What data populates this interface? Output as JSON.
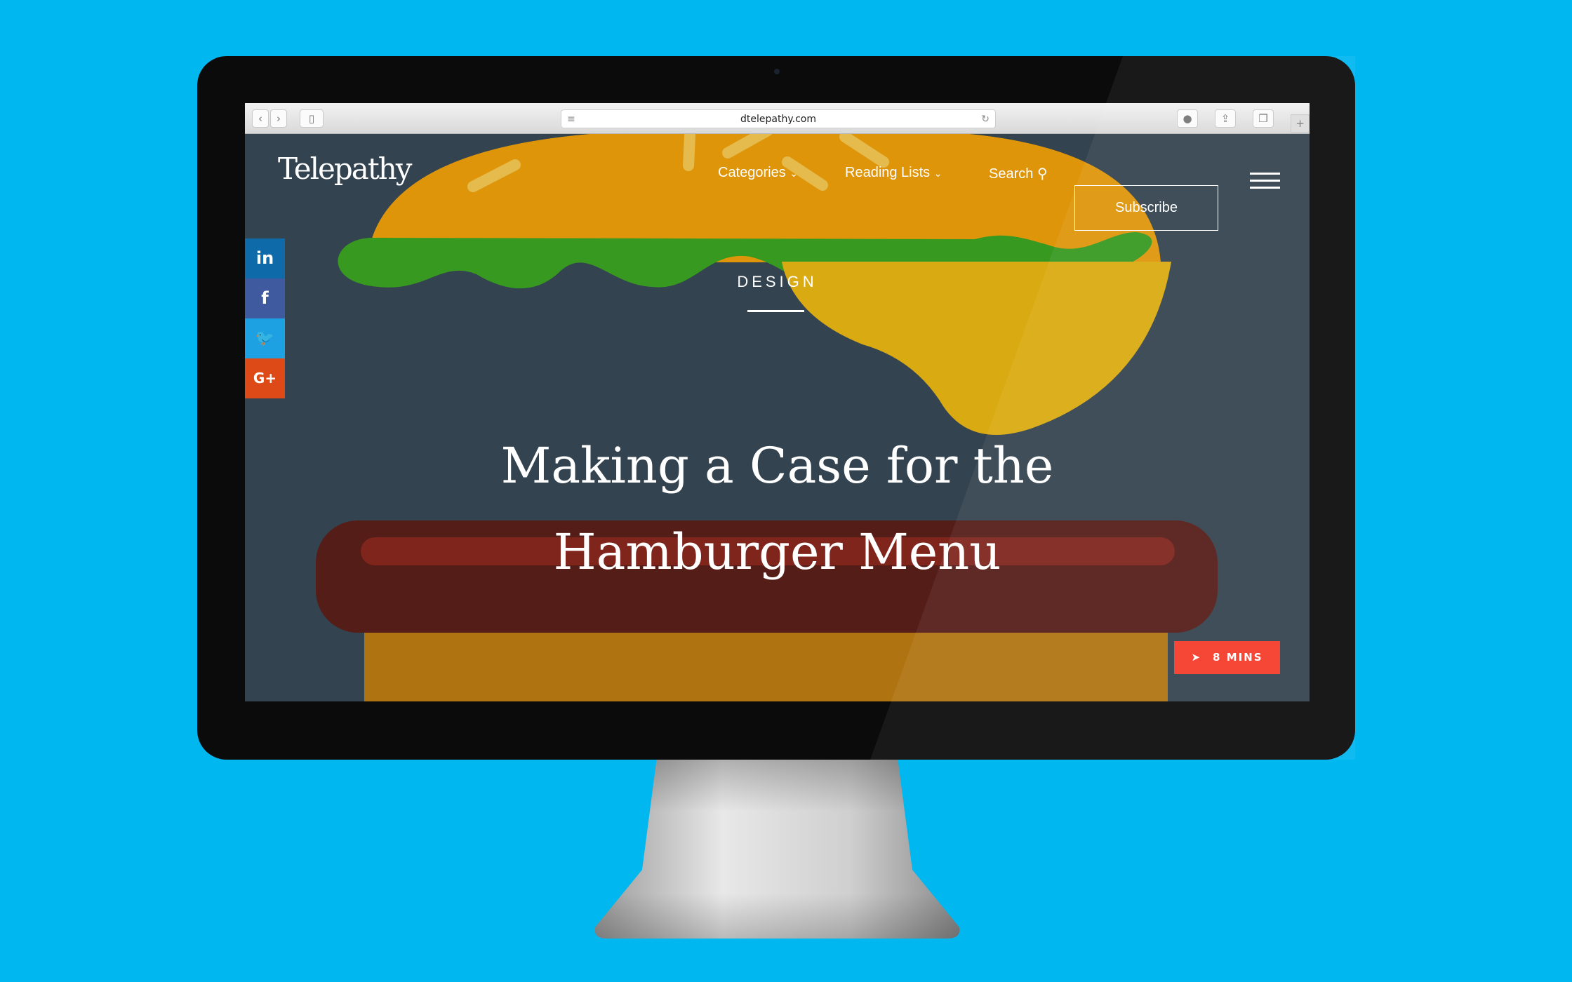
{
  "browser": {
    "url": "dtelepathy.com",
    "back_icon": "‹",
    "forward_icon": "›"
  },
  "site": {
    "logo": "Telepathy",
    "nav": [
      {
        "label": "Categories",
        "icon": "chevron-down-icon"
      },
      {
        "label": "Reading Lists",
        "icon": "chevron-down-icon"
      },
      {
        "label": "Search",
        "icon": "search-icon"
      }
    ],
    "subscribe": "Subscribe"
  },
  "social": [
    {
      "label": "in",
      "name": "linkedin",
      "color": "#0e6aa8"
    },
    {
      "label": "f",
      "name": "facebook",
      "color": "#3f5a9e"
    },
    {
      "label": "🐦",
      "name": "twitter",
      "color": "#1da1e2"
    },
    {
      "label": "G+",
      "name": "google-plus",
      "color": "#dd4a18"
    }
  ],
  "article": {
    "category": "DESIGN",
    "title_line1": "Making a Case for the",
    "title_line2": "Hamburger Menu",
    "read_time": "8 MINS"
  },
  "colors": {
    "background": "#00b7f0",
    "badge": "#f53b2a",
    "bun": "#f7a100",
    "lettuce": "#3aa61a",
    "cheese": "#f2b90a",
    "patty": "#5a1810"
  }
}
